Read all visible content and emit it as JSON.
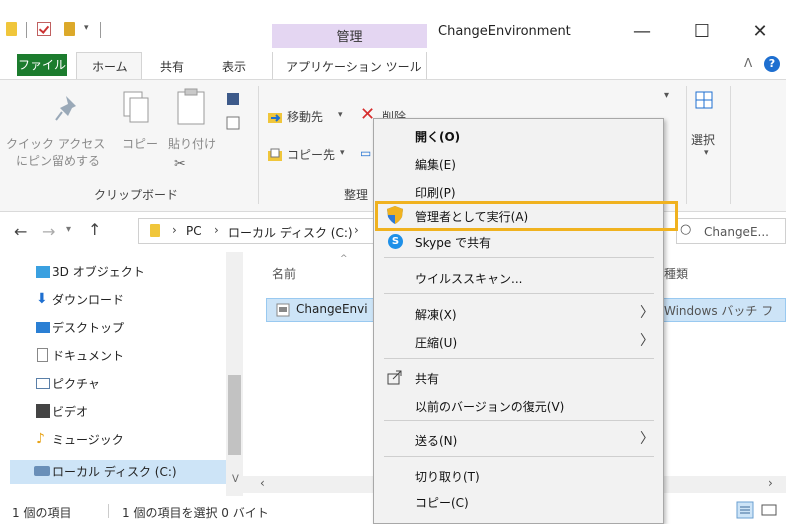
{
  "window": {
    "title": "ChangeEnvironment",
    "context_group": "管理",
    "controls": {
      "minimize": "—",
      "maximize": "☐",
      "close": "✕"
    }
  },
  "ribbon": {
    "tabs": {
      "file": "ファイル",
      "home": "ホーム",
      "share": "共有",
      "view": "表示",
      "app_tools": "アプリケーション ツール"
    },
    "clipboard": {
      "quick_access_line1": "クイック アクセス",
      "quick_access_line2": "にピン留めする",
      "copy": "コピー",
      "paste": "貼り付け",
      "group_label": "クリップボード"
    },
    "organize": {
      "move_to": "移動先",
      "delete": "削除",
      "copy_to": "コピー先",
      "group_label": "整理"
    },
    "select": {
      "label": "選択"
    }
  },
  "address": {
    "path": [
      "PC",
      "ローカル ディスク (C:)"
    ],
    "search_placeholder": "ChangeE..."
  },
  "nav_pane": {
    "items": [
      {
        "label": "3D オブジェクト",
        "icon": "cube-3d-icon",
        "color": "#3aa0e0"
      },
      {
        "label": "ダウンロード",
        "icon": "download-arrow-icon",
        "color": "#1e6fd0"
      },
      {
        "label": "デスクトップ",
        "icon": "desktop-icon",
        "color": "#2a7fd4"
      },
      {
        "label": "ドキュメント",
        "icon": "document-icon",
        "color": "#888888"
      },
      {
        "label": "ピクチャ",
        "icon": "pictures-icon",
        "color": "#5a7fa8"
      },
      {
        "label": "ビデオ",
        "icon": "video-icon",
        "color": "#444444"
      },
      {
        "label": "ミュージック",
        "icon": "music-note-icon",
        "color": "#e8a317"
      },
      {
        "label": "ローカル ディスク (C:)",
        "icon": "drive-icon",
        "color": "#6a8fb8"
      }
    ]
  },
  "file_list": {
    "columns": {
      "name": "名前",
      "type": "種類"
    },
    "rows": [
      {
        "name": "ChangeEnvi",
        "type": "Windows バッチ フ"
      }
    ]
  },
  "status": {
    "count": "1 個の項目",
    "selected": "1 個の項目を選択 0 バイト"
  },
  "context_menu": {
    "items": {
      "open": "開く(O)",
      "edit": "編集(E)",
      "print": "印刷(P)",
      "run_as_admin": "管理者として実行(A)",
      "skype_share": "Skype で共有",
      "virus_scan": "ウイルススキャン...",
      "extract": "解凍(X)",
      "compress": "圧縮(U)",
      "share": "共有",
      "restore_versions": "以前のバージョンの復元(V)",
      "send_to": "送る(N)",
      "cut": "切り取り(T)",
      "copy": "コピー(C)"
    },
    "highlight_color": "#f0b21f"
  },
  "colors": {
    "accent": "#1e6fd0",
    "file_tab": "#1c7c2e",
    "context_band": "#e4d6f2",
    "selection": "#cde4f7"
  }
}
